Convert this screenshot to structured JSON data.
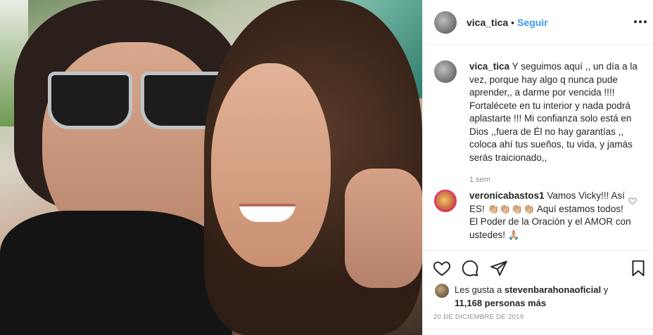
{
  "post": {
    "username": "vica_tica",
    "separator": "•",
    "follow_label": "Seguir",
    "caption": {
      "username": "vica_tica",
      "text": "Y seguimos aquí ,, un día a la vez, porque hay algo q nunca pude aprender,, a darme por vencida !!!! Fortalécete en tu interior y nada podrá aplastarte !!! Mi confianza solo está en Dios ,,fuera de Él no hay garantías ,, coloca ahí tus sueños, tu vida, y jamás serás traicionado,,",
      "time": "1 sem"
    },
    "comment": {
      "username": "veronicabastos1",
      "text": "Vamos Vicky!!! Así ES! 👏🏼👏🏼👏🏼👏🏼 Aquí estamos todos! El Poder de la Oración y el AMOR con ustedes! 🙏🏼"
    },
    "likes": {
      "prefix": "Les gusta a",
      "user": "stevenbarahonaoficial",
      "conjunction": "y",
      "count": "11,168 personas más"
    },
    "date": "20 DE DICIEMBRE DE 2019"
  },
  "icons": {
    "more": "more-options-icon",
    "like": "heart-icon",
    "comment": "comment-icon",
    "share": "share-icon",
    "save": "bookmark-icon"
  }
}
